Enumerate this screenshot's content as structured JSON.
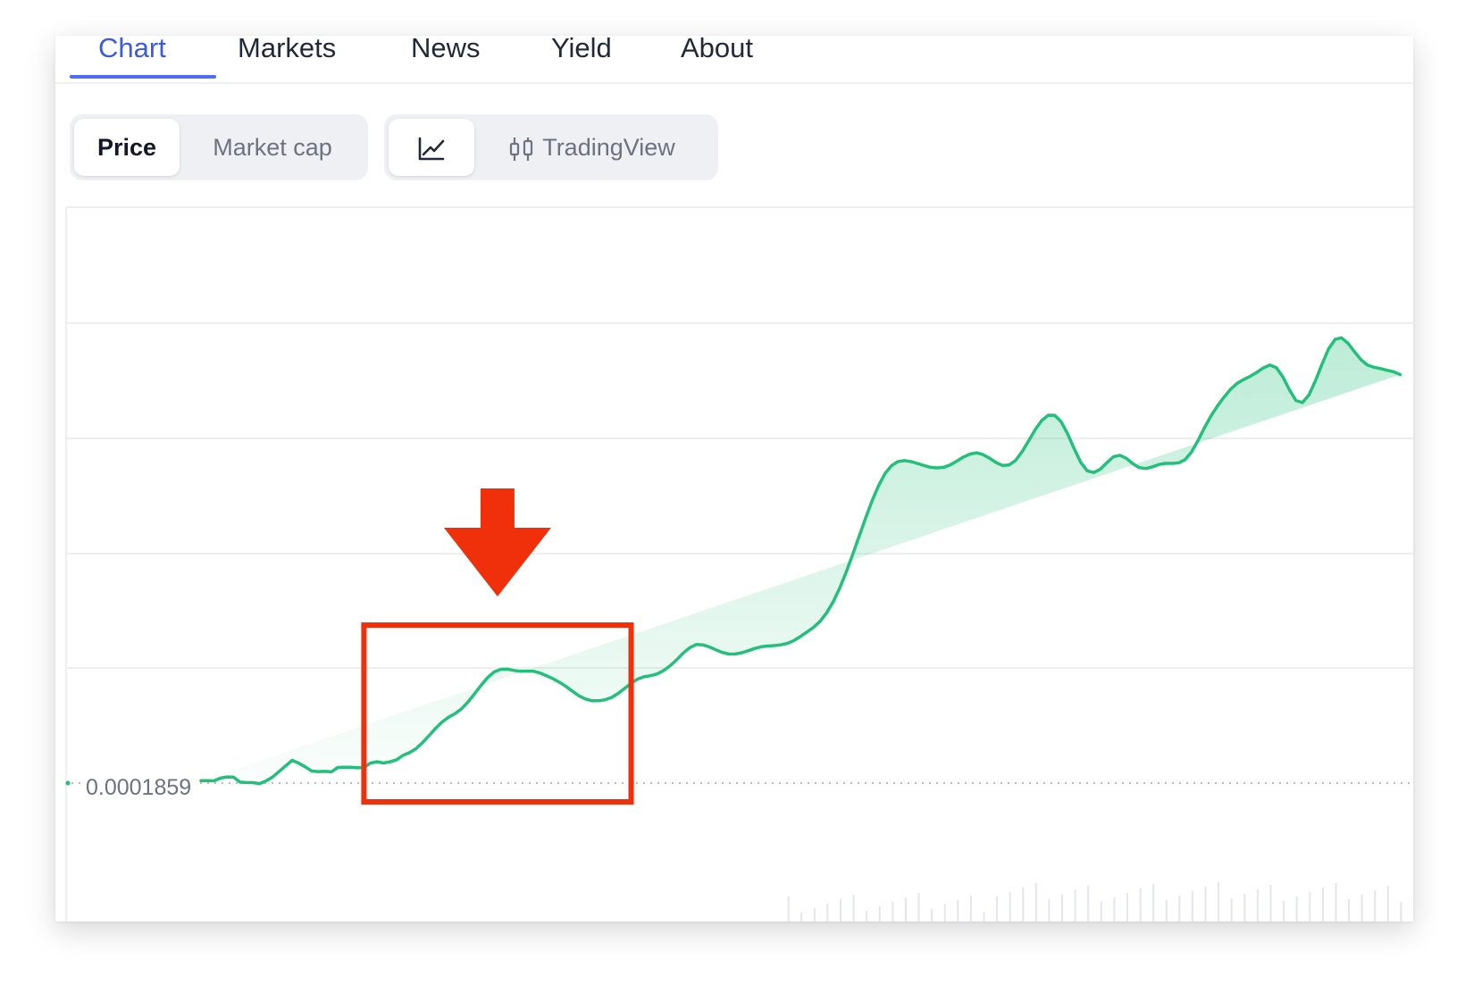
{
  "tabs": [
    {
      "label": "Chart",
      "active": true
    },
    {
      "label": "Markets",
      "active": false
    },
    {
      "label": "News",
      "active": false
    },
    {
      "label": "Yield",
      "active": false
    },
    {
      "label": "About",
      "active": false
    }
  ],
  "metric_toggle": {
    "options": [
      {
        "label": "Price",
        "selected": true
      },
      {
        "label": "Market cap",
        "selected": false
      }
    ]
  },
  "view_toggle": {
    "options": [
      {
        "label": "",
        "icon": "line-chart-icon",
        "selected": true
      },
      {
        "label": "TradingView",
        "icon": "candlestick-icon",
        "selected": false
      }
    ]
  },
  "chart": {
    "reference_price_label": "0.0001859",
    "colors": {
      "line": "#22c07a",
      "area": "#22c07a",
      "annotation": "#f0300a",
      "accent": "#4c6ef5"
    }
  },
  "chart_data": {
    "type": "area",
    "title": "",
    "xlabel": "",
    "ylabel": "",
    "x": [
      1,
      2,
      3,
      4,
      5,
      6,
      7,
      8,
      9,
      10,
      11,
      12,
      13,
      14,
      15,
      16,
      17,
      18,
      19,
      20,
      21,
      22,
      23,
      24,
      25,
      26,
      27,
      28,
      29,
      30,
      31,
      32,
      33,
      34,
      35,
      36,
      37,
      38,
      39,
      40,
      41,
      42,
      43,
      44,
      45,
      46,
      47,
      48,
      49,
      50,
      51,
      52,
      53,
      54,
      55,
      56,
      57,
      58,
      59,
      60,
      61,
      62,
      63,
      64,
      65,
      66,
      67,
      68,
      69,
      70,
      71,
      72,
      73,
      74,
      75,
      76,
      77,
      78,
      79,
      80,
      81,
      82,
      83,
      84,
      85,
      86,
      87,
      88,
      89,
      90,
      91,
      92,
      93,
      94,
      95,
      96,
      97,
      98,
      99,
      100,
      101,
      102,
      103,
      104,
      105,
      106,
      107,
      108,
      109,
      110,
      111,
      112,
      113,
      114,
      115,
      116,
      117,
      118,
      119,
      120,
      121,
      122,
      123,
      124,
      125,
      126,
      127,
      128,
      129,
      130,
      131,
      132,
      133,
      134,
      135,
      136,
      137,
      138,
      139,
      140,
      141,
      142,
      143,
      144,
      145,
      146,
      147,
      148,
      149,
      150,
      151,
      152,
      153,
      154,
      155,
      156,
      157,
      158,
      159,
      160,
      161,
      162,
      163,
      164,
      165,
      166,
      167,
      168,
      169,
      170,
      171,
      172,
      173,
      174,
      175,
      176,
      177,
      178,
      179,
      180,
      181,
      182,
      183,
      184,
      185,
      186,
      187
    ],
    "series": [
      {
        "values": [
          0.00018718,
          0.00018718,
          0.00018705,
          0.00018849,
          0.0001891,
          0.00018894,
          0.00018634,
          0.00018618,
          0.00018612,
          0.00018564,
          0.00018706,
          0.00018907,
          0.00019193,
          0.0001948,
          0.00019769,
          0.00019618,
          0.0001943,
          0.00019207,
          0.00019187,
          0.00019193,
          0.00019173,
          0.00019398,
          0.00019409,
          0.00019411,
          0.0001938,
          0.00019392,
          0.00019622,
          0.00019693,
          0.00019628,
          0.0001969,
          0.00019794,
          0.00020026,
          0.00020163,
          0.00020371,
          0.00020686,
          0.00021047,
          0.00021421,
          0.00021749,
          0.00021996,
          0.00022188,
          0.00022438,
          0.00022791,
          0.00023218,
          0.00023659,
          0.00024054,
          0.00024342,
          0.00024474,
          0.00024482,
          0.00024418,
          0.00024374,
          0.00024386,
          0.00024375,
          0.00024283,
          0.00024146,
          0.00023986,
          0.00023801,
          0.00023591,
          0.00023338,
          0.00023099,
          0.00022938,
          0.00022845,
          0.00022846,
          0.00022897,
          0.00023017,
          0.00023224,
          0.00023484,
          0.00023752,
          0.00023971,
          0.00024091,
          0.00024146,
          0.00024236,
          0.00024413,
          0.00024664,
          0.00024973,
          0.00025317,
          0.00025596,
          0.00025758,
          0.00025737,
          0.0002563,
          0.00025486,
          0.00025343,
          0.00025263,
          0.00025267,
          0.0002533,
          0.00025437,
          0.00025555,
          0.00025642,
          0.00025678,
          0.000257,
          0.0002574,
          0.00025818,
          0.00025966,
          0.00026177,
          0.00026409,
          0.00026646,
          0.00026958,
          0.00027393,
          0.00027964,
          0.00028675,
          0.00029499,
          0.00030418,
          0.00031372,
          0.00032317,
          0.0003322,
          0.00034,
          0.00034618,
          0.0003502,
          0.00035228,
          0.00035263,
          0.00035211,
          0.00035111,
          0.00035004,
          0.00034916,
          0.00034891,
          0.0003492,
          0.00035052,
          0.00035243,
          0.00035452,
          0.00035603,
          0.00035671,
          0.00035579,
          0.00035389,
          0.00035165,
          0.00035012,
          0.0003504,
          0.0003528,
          0.00035733,
          0.00036298,
          0.00036862,
          0.00037335,
          0.00037613,
          0.00037611,
          0.00037274,
          0.00036635,
          0.00035866,
          0.00035172,
          0.00034736,
          0.00034647,
          0.00034826,
          0.00035159,
          0.00035465,
          0.0003554,
          0.00035384,
          0.000351,
          0.00034898,
          0.00034855,
          0.00034944,
          0.00035064,
          0.00035126,
          0.00035119,
          0.00035147,
          0.00035316,
          0.00035712,
          0.00036311,
          0.00036981,
          0.00037589,
          0.00038101,
          0.00038556,
          0.00038962,
          0.00039265,
          0.0003946,
          0.00039625,
          0.00039831,
          0.00040056,
          0.00040207,
          0.00040072,
          0.00039596,
          0.00038928,
          0.00038376,
          0.00038264,
          0.00038663,
          0.00039398,
          0.00040245,
          0.00041034,
          0.00041535,
          0.00041615,
          0.00041337,
          0.00040898,
          0.00040482,
          0.00040205,
          0.00040095,
          0.00040023,
          0.00039935,
          0.00039861,
          0.00039715
        ]
      }
    ],
    "reference_line": 0.0001859,
    "legend": "none",
    "grid": "horizontal",
    "highlight": {
      "shape": "rectangle-with-down-arrow",
      "x_range": [
        26,
        67
      ]
    }
  }
}
